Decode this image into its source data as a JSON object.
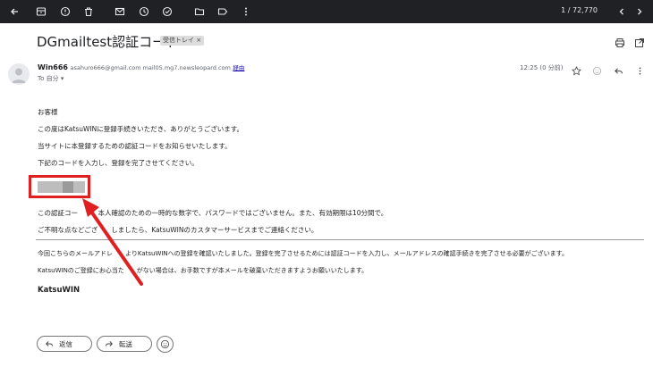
{
  "toolbar": {
    "icons": [
      "back-icon",
      "archive-icon",
      "spam-icon",
      "delete-icon",
      "mark-unread-icon",
      "snooze-icon",
      "add-task-icon",
      "move-to-icon",
      "label-icon",
      "more-icon"
    ],
    "count": "1 / 72,770"
  },
  "email": {
    "subject": "DGmailtest認証コード",
    "label": "受信トレイ ×",
    "sender_name": "Win666",
    "sender_addr": "asahuro666@gmail.com mail05.mg7.newsleopard.com",
    "unsubscribe": "経由",
    "to": "To 自分 ▾",
    "time": "12:25 (0 分前)"
  },
  "body": {
    "greeting": "お客様",
    "line1": "この度はKatsuWINに登録手続きいただき、ありがとうございます。",
    "line2": "当サイトに本登録するための認証コードをお知らせいたします。",
    "line3": "下記のコードを入力し、登録を完了させてください。",
    "line4": "この認証コー　　、本人確認のための一時的な数字で、パスワードではございません。また、有効期限は10分間で。",
    "line5": "ご不明な点などござ　　しましたら、KatsuWINのカスタマーサービスまでご連絡ください。",
    "line6": "今回こちらのメールアドレ　　よりKatsuWINへの登録を確認いたしました。登録を完了させるためには認証コードを入力し、メールアドレスの確認手続きを完了させる必要がございます。",
    "line7": "KatsuWINのご登録にお心当た　　がない場合は、お手数ですが本メールを破棄いただきますようお願いいたします。",
    "signature": "KatsuWIN"
  },
  "actions": {
    "reply": "返信",
    "forward": "転送"
  },
  "colors": {
    "toolbar_bg": "#202124",
    "highlight": "#e02020"
  }
}
